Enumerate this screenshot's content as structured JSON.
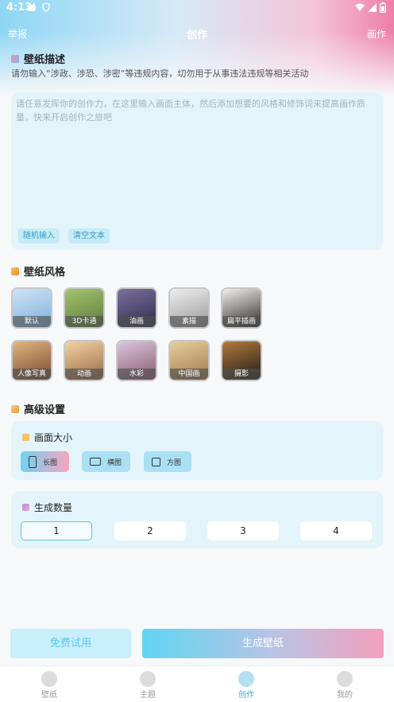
{
  "status_bar": {
    "time": "4:13"
  },
  "navbar": {
    "left": "举报",
    "title": "创作",
    "right": "画作"
  },
  "description": {
    "title": "壁纸描述",
    "warning": "请勿输入“涉政、涉恐、涉密”等违规内容，切勿用于从事违法违规等相关活动",
    "placeholder": "请任意发挥你的创作力，在这里输入画面主体，然后添加想要的风格和修饰词来提高画作质量，快来开启创作之旅吧",
    "chips": [
      "随机输入",
      "清空文本"
    ]
  },
  "styles": {
    "title": "壁纸风格",
    "items": [
      {
        "label": "默认",
        "colors": [
          "#cfe3f5",
          "#7fb1dd"
        ]
      },
      {
        "label": "3D卡通",
        "colors": [
          "#a5c36f",
          "#5b7c3a"
        ]
      },
      {
        "label": "油画",
        "colors": [
          "#7b6f9e",
          "#2e2d4b"
        ]
      },
      {
        "label": "素描",
        "colors": [
          "#eeeeee",
          "#9a9a9a"
        ]
      },
      {
        "label": "扁平插画",
        "colors": [
          "#f4f0ea",
          "#2b2b2b"
        ]
      },
      {
        "label": "人像写真",
        "colors": [
          "#e0b583",
          "#7a4a2e"
        ]
      },
      {
        "label": "动画",
        "colors": [
          "#f2d3a3",
          "#9b6a46"
        ]
      },
      {
        "label": "水彩",
        "colors": [
          "#d9c7de",
          "#8a5b6e"
        ]
      },
      {
        "label": "中国画",
        "colors": [
          "#e6cf9e",
          "#a2794a"
        ]
      },
      {
        "label": "摄影",
        "colors": [
          "#b37b3f",
          "#1d1a17"
        ]
      }
    ]
  },
  "advanced": {
    "title": "高级设置",
    "size": {
      "title": "画面大小",
      "options": [
        "长图",
        "横图",
        "方图"
      ],
      "selected": "长图"
    },
    "count": {
      "title": "生成数量",
      "options": [
        "1",
        "2",
        "3",
        "4"
      ],
      "selected": "1"
    }
  },
  "actions": {
    "free_trial": "免费试用",
    "generate": "生成壁纸"
  },
  "tabbar": {
    "items": [
      "壁纸",
      "主题",
      "创作",
      "我的"
    ],
    "active": "创作"
  },
  "colors": {
    "accent": "#3aa9d6",
    "card_bg": "#e3f4fa",
    "gradient_pink": "#f59fbd",
    "gradient_blue": "#61d5f3"
  }
}
